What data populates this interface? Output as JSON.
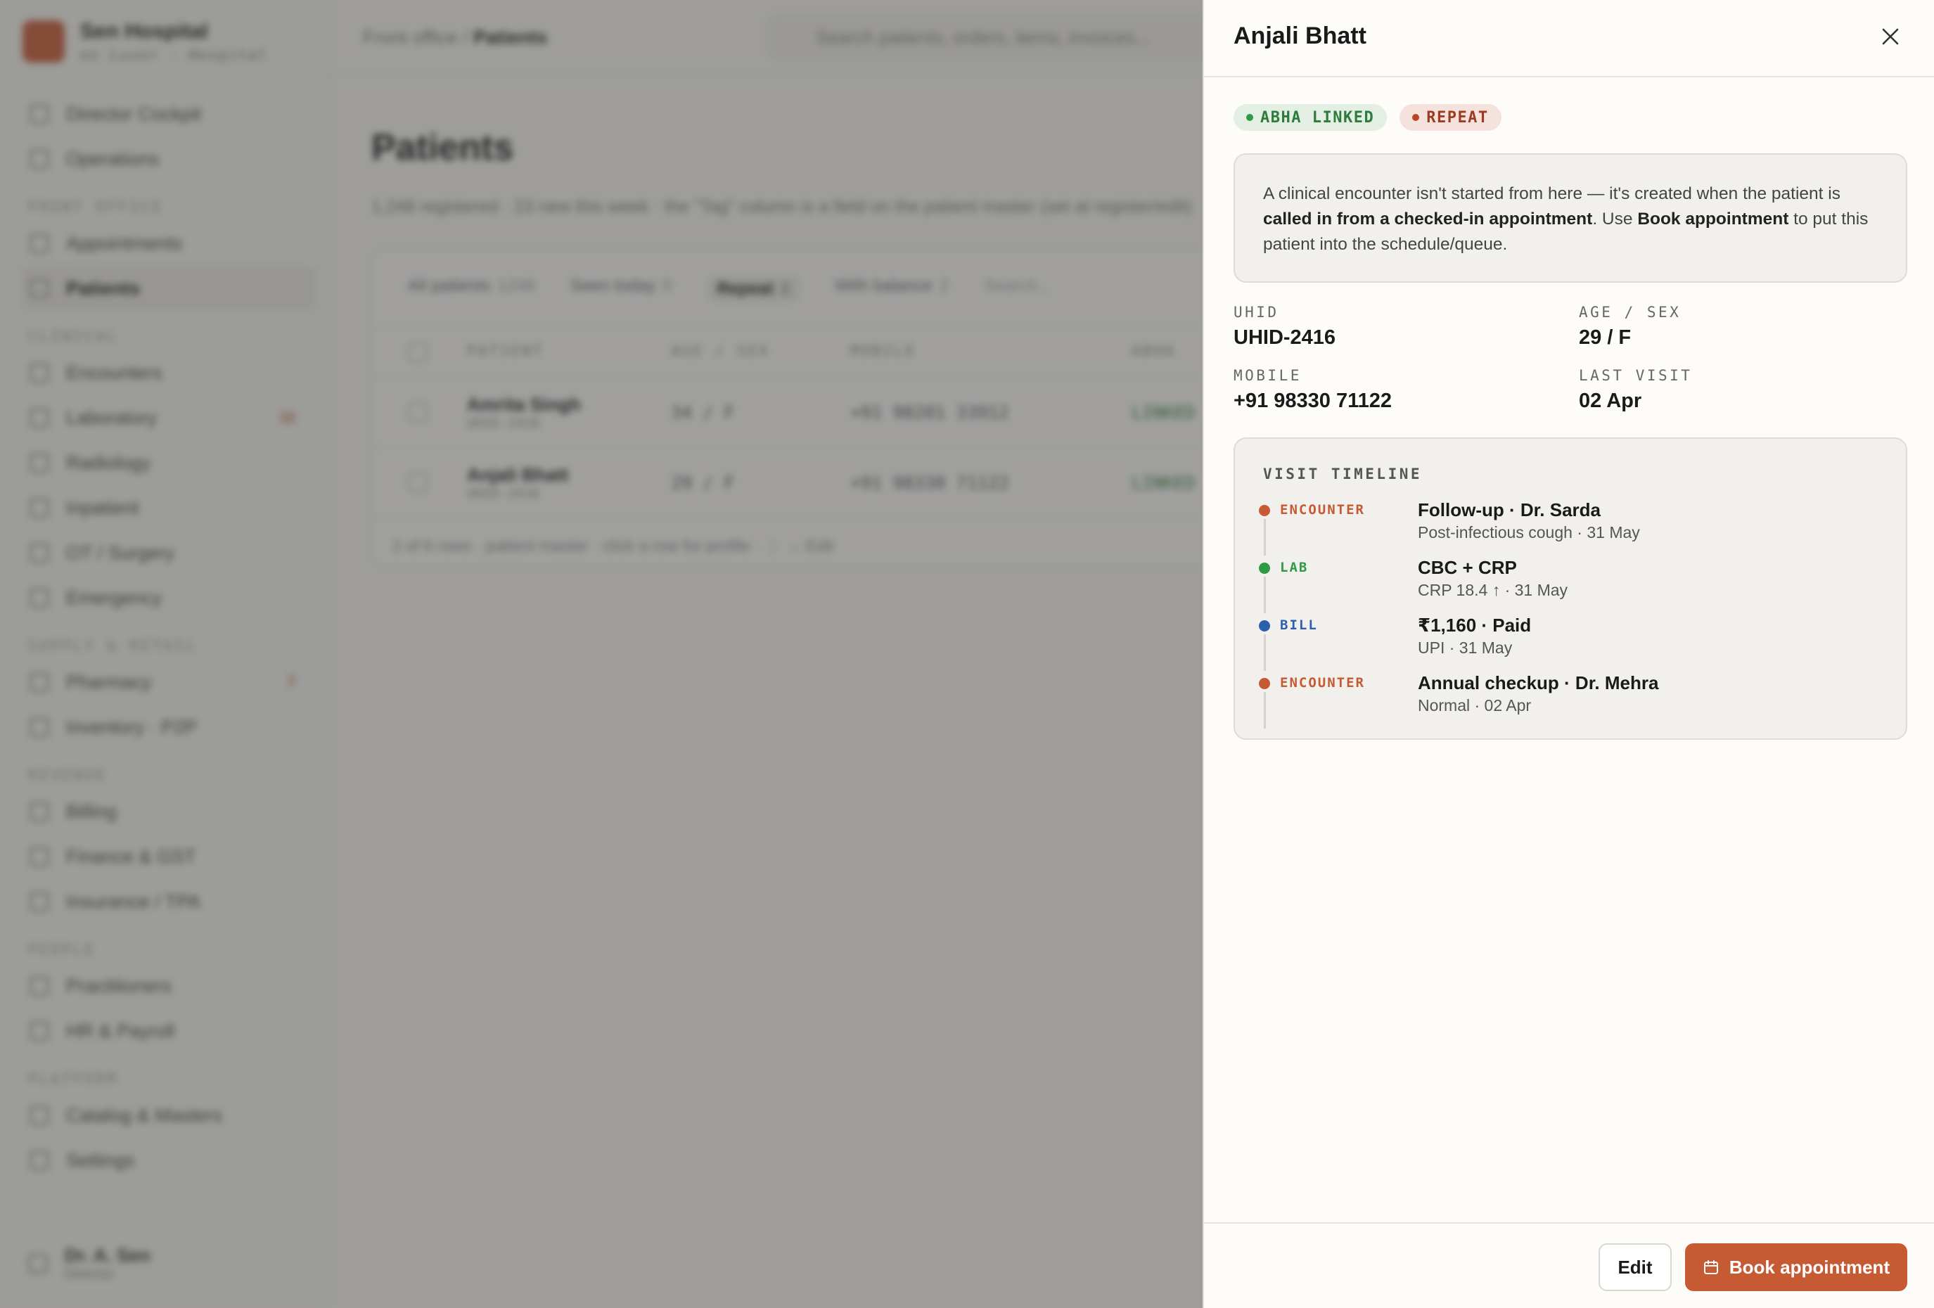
{
  "brand": {
    "name": "Sen Hospital",
    "subtitle": "on Luxor · Hospital"
  },
  "sidebar": {
    "items": [
      {
        "label": "Director Cockpit"
      },
      {
        "label": "Operations"
      },
      {
        "section": "FRONT OFFICE"
      },
      {
        "label": "Appointments"
      },
      {
        "label": "Patients",
        "active": true
      },
      {
        "section": "CLINICAL"
      },
      {
        "label": "Encounters"
      },
      {
        "label": "Laboratory",
        "badge": "12"
      },
      {
        "label": "Radiology"
      },
      {
        "label": "Inpatient"
      },
      {
        "label": "OT / Surgery"
      },
      {
        "label": "Emergency"
      },
      {
        "section": "SUPPLY & RETAIL"
      },
      {
        "label": "Pharmacy",
        "badge": "7"
      },
      {
        "label": "Inventory · P2P"
      },
      {
        "section": "REVENUE"
      },
      {
        "label": "Billing"
      },
      {
        "label": "Finance & GST"
      },
      {
        "label": "Insurance / TPA"
      },
      {
        "section": "PEOPLE"
      },
      {
        "label": "Practitioners"
      },
      {
        "label": "HR & Payroll"
      },
      {
        "section": "PLATFORM"
      },
      {
        "label": "Catalog & Masters"
      },
      {
        "label": "Settings"
      }
    ],
    "user": {
      "name": "Dr. A. Sen",
      "role": "Director"
    }
  },
  "topbar": {
    "breadcrumb_parent": "Front office / ",
    "breadcrumb_current": "Patients",
    "search_placeholder": "Search patients, orders, items, invoices..."
  },
  "main": {
    "title": "Patients",
    "subtitle": "1,248 registered · 23 new this week · the \"Tag\" column is a field on the patient master (set at register/edit)",
    "filters": [
      {
        "label": "All patients",
        "count": "1248"
      },
      {
        "label": "Seen today",
        "count": "0"
      },
      {
        "label": "Repeat",
        "count": "2",
        "active": true
      },
      {
        "label": "With balance",
        "count": "2"
      }
    ],
    "table_search_placeholder": "Search...",
    "columns": [
      "PATIENT",
      "AGE / SEX",
      "MOBILE",
      "ABHA"
    ],
    "rows": [
      {
        "name": "Amrita Singh",
        "uhid": "UHID-2418",
        "age_sex": "34 / F",
        "mobile": "+91 98201 33912",
        "abha": "LINKED"
      },
      {
        "name": "Anjali Bhatt",
        "uhid": "UHID-2416",
        "age_sex": "29 / F",
        "mobile": "+91 98330 71122",
        "abha": "LINKED"
      }
    ],
    "footer": "2 of 6 rows · patient master · click a row for profile · ⋮ → Edit"
  },
  "drawer": {
    "title": "Anjali Bhatt",
    "chips": [
      {
        "label": "ABHA LINKED",
        "color": "#2f7a3d"
      },
      {
        "label": "REPEAT",
        "color": "#9b3c22"
      }
    ],
    "note": {
      "t1": "A clinical encounter isn't started from here — it's created when the patient is ",
      "b1": "called in from a checked-in appointment",
      "t2": ". Use ",
      "b2": "Book appointment",
      "t3": " to put this patient into the schedule/queue."
    },
    "facts": {
      "uhid_label": "UHID",
      "uhid": "UHID-2416",
      "age_sex_label": "AGE / SEX",
      "age_sex": "29 / F",
      "mobile_label": "MOBILE",
      "mobile": "+91 98330 71122",
      "last_visit_label": "LAST VISIT",
      "last_visit": "02 Apr"
    },
    "timeline": {
      "title": "VISIT TIMELINE",
      "items": [
        {
          "kind": "ENCOUNTER",
          "title": "Follow-up · Dr. Sarda",
          "sub": "Post-infectious cough · 31 May",
          "color": "#c65a33"
        },
        {
          "kind": "LAB",
          "title": "CBC + CRP",
          "sub": "CRP 18.4 ↑ · 31 May",
          "color": "#2f9a46"
        },
        {
          "kind": "BILL",
          "title": "₹1,160 · Paid",
          "sub": "UPI · 31 May",
          "color": "#2b5fb0"
        },
        {
          "kind": "ENCOUNTER",
          "title": "Annual checkup · Dr. Mehra",
          "sub": "Normal · 02 Apr",
          "color": "#c65a33"
        }
      ]
    },
    "buttons": {
      "edit": "Edit",
      "book": "Book appointment"
    }
  }
}
